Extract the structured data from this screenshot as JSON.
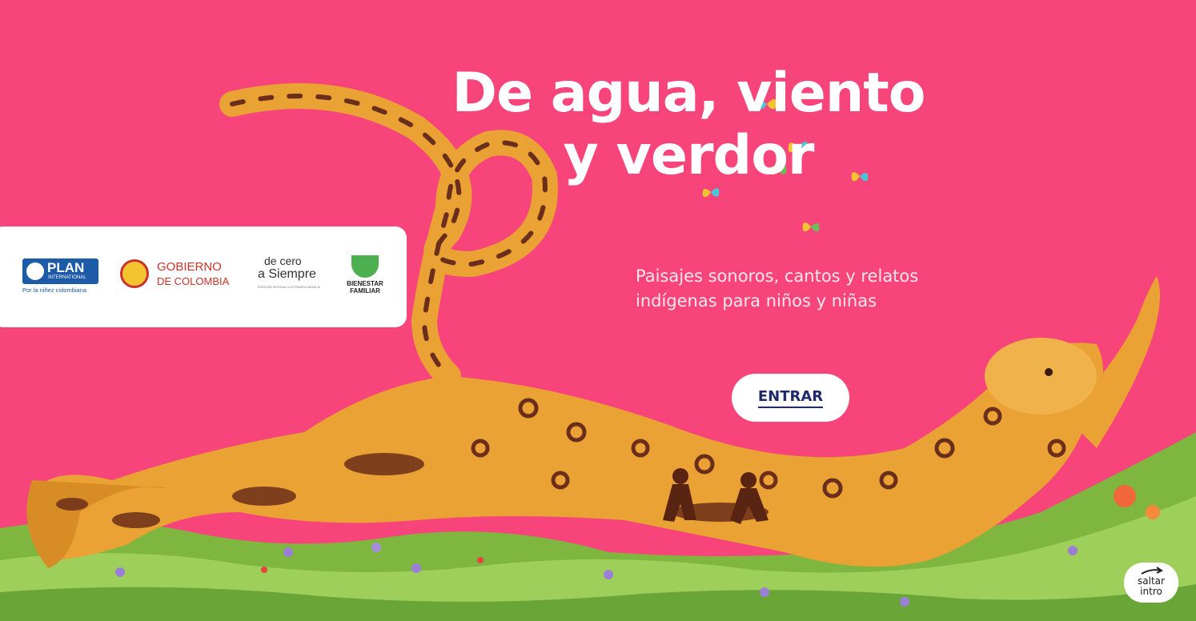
{
  "hero": {
    "title_line1": "De agua, viento",
    "title_line2": "y verdor",
    "subtitle_line1": "Paisajes sonoros, cantos y relatos",
    "subtitle_line2": "indígenas para niños y niñas"
  },
  "logos": {
    "plan": {
      "name": "PLAN",
      "sub": "INTERNATIONAL",
      "tagline": "Por la niñez colombiana"
    },
    "gobierno": {
      "line1": "GOBIERNO",
      "line2": "DE COLOMBIA"
    },
    "decero": {
      "name_a": "de cero",
      "name_b": "a Siempre",
      "tagline": "ATENCIÓN INTEGRAL A LA PRIMERA INFANCIA"
    },
    "bienestar": {
      "line1": "BIENESTAR",
      "line2": "FAMILIAR"
    }
  },
  "actions": {
    "enter_label": "ENTRAR",
    "skip_line1": "saltar",
    "skip_line2": "intro"
  },
  "icons": {
    "jaguar": "jaguar-illustration",
    "butterfly": "butterfly-icon",
    "skip": "skip-arrow-icon"
  },
  "colors": {
    "background": "#f7447a",
    "jaguar": "#e9a233",
    "grass": "#8bc34a",
    "enter_text": "#1e2a6b"
  }
}
